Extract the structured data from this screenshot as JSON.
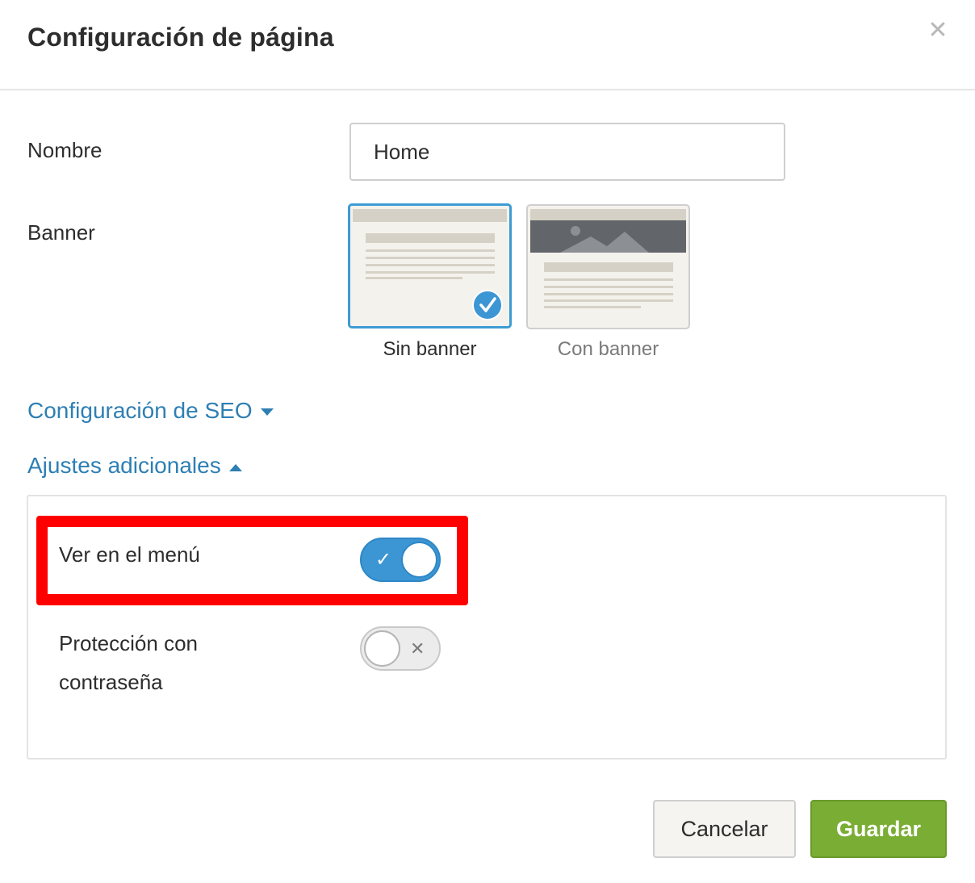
{
  "dialog": {
    "title": "Configuración de página",
    "close_icon": "close-icon"
  },
  "form": {
    "name_label": "Nombre",
    "name_value": "Home",
    "banner_label": "Banner",
    "banner_options": [
      {
        "label": "Sin banner",
        "selected": true
      },
      {
        "label": "Con banner",
        "selected": false
      }
    ]
  },
  "sections": {
    "seo_label": "Configuración de SEO",
    "seo_icon": "caret-down-icon",
    "additional_label": "Ajustes adicionales",
    "additional_icon": "caret-up-icon"
  },
  "settings": {
    "menu_label": "Ver en el menú",
    "menu_enabled": true,
    "menu_glyph": "✓",
    "password_label_line1": "Protección con",
    "password_label_line2": "contraseña",
    "password_enabled": false,
    "password_glyph": "✕"
  },
  "footer": {
    "cancel_label": "Cancelar",
    "save_label": "Guardar"
  },
  "colors": {
    "accent": "#3d96d4",
    "link": "#2e7fb3",
    "save": "#7aad34",
    "highlight": "#ff0000"
  }
}
